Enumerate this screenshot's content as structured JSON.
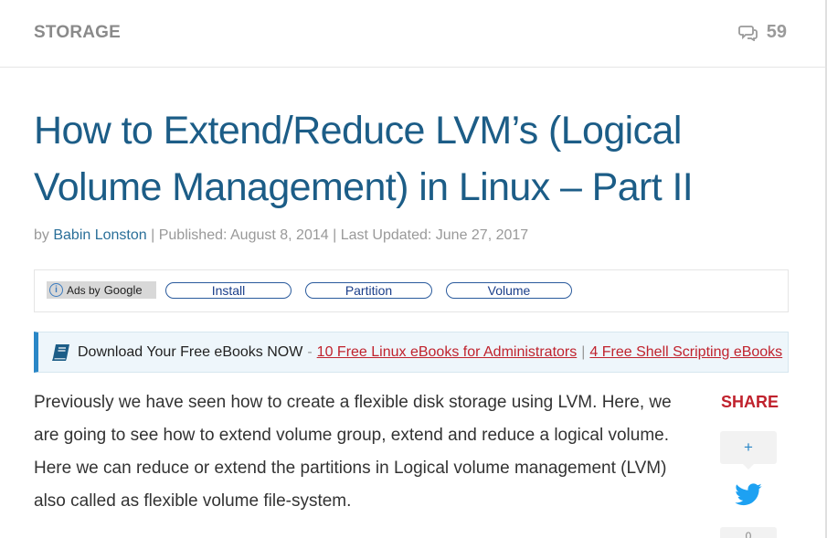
{
  "header": {
    "category": "STORAGE",
    "comment_count": "59"
  },
  "article": {
    "title": "How to Extend/Reduce LVM’s (Logical Volume Management) in Linux – Part II",
    "meta": {
      "by": "by",
      "author": "Babin Lonston",
      "published": "| Published: August 8, 2014 | Last Updated: June 27, 2017"
    },
    "body": "Previously we have seen how to create a flexible disk storage using LVM. Here, we are going to see how to extend volume group, extend and reduce a logical volume. Here we can reduce or extend the partitions in Logical volume management (LVM) also called as flexible volume file-system."
  },
  "ads": {
    "label": "Ads by",
    "brand": "Google",
    "links": [
      "Install",
      "Partition",
      "Volume"
    ]
  },
  "ebook_banner": {
    "lead": "Download Your Free eBooks NOW",
    "dash": "-",
    "link1": "10 Free Linux eBooks for Administrators",
    "sep": "|",
    "link2": "4 Free Shell Scripting eBooks"
  },
  "share": {
    "label": "SHARE",
    "plus": "+",
    "next_count": "0"
  },
  "colors": {
    "title": "#1c5d87",
    "link_red": "#c0222d",
    "accent_blue": "#2a87c7",
    "twitter": "#1da1f2"
  }
}
